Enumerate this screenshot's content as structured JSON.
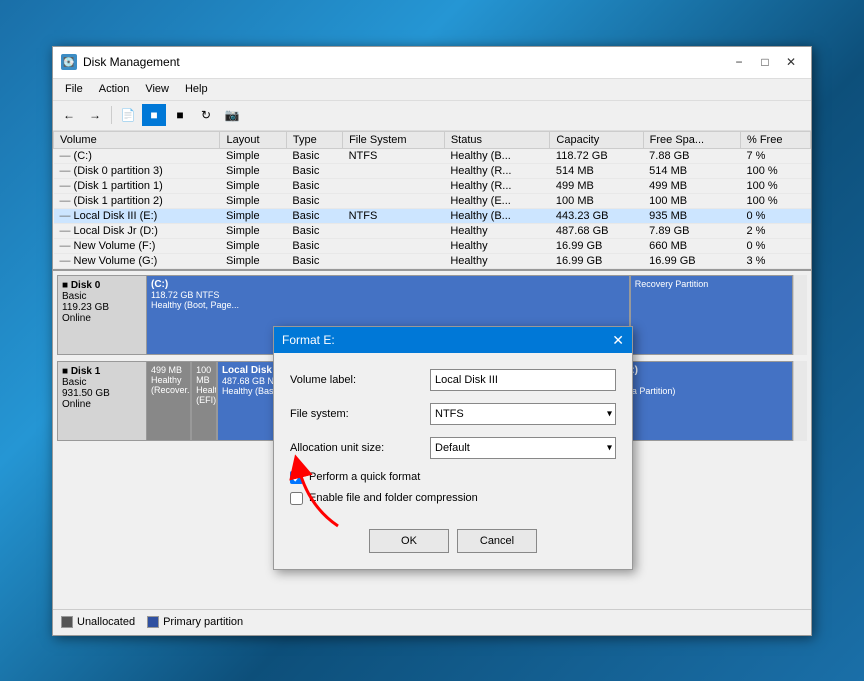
{
  "window": {
    "title": "Disk Management",
    "icon": "💽"
  },
  "menu": {
    "items": [
      "File",
      "Action",
      "View",
      "Help"
    ]
  },
  "table": {
    "headers": [
      "Volume",
      "Layout",
      "Type",
      "File System",
      "Status",
      "Capacity",
      "Free Spa...",
      "% Free"
    ],
    "rows": [
      [
        "(C:)",
        "Simple",
        "Basic",
        "NTFS",
        "Healthy (B...",
        "118.72 GB",
        "7.88 GB",
        "7 %"
      ],
      [
        "(Disk 0 partition 3)",
        "Simple",
        "Basic",
        "",
        "Healthy (R...",
        "514 MB",
        "514 MB",
        "100 %"
      ],
      [
        "(Disk 1 partition 1)",
        "Simple",
        "Basic",
        "",
        "Healthy (R...",
        "499 MB",
        "499 MB",
        "100 %"
      ],
      [
        "(Disk 1 partition 2)",
        "Simple",
        "Basic",
        "",
        "Healthy (E...",
        "100 MB",
        "100 MB",
        "100 %"
      ],
      [
        "Local Disk III (E:)",
        "Simple",
        "Basic",
        "NTFS",
        "Healthy (B...",
        "443.23 GB",
        "935 MB",
        "0 %"
      ],
      [
        "Local Disk Jr (D:)",
        "Simple",
        "Basic",
        "",
        "Healthy",
        "487.68 GB",
        "7.89 GB",
        "2 %"
      ],
      [
        "New Volume (F:)",
        "Simple",
        "Basic",
        "",
        "Healthy",
        "16.99 GB",
        "660 MB",
        "0 %"
      ],
      [
        "New Volume (G:)",
        "Simple",
        "Basic",
        "",
        "Healthy",
        "16.99 GB",
        "16.99 GB",
        "3 %"
      ]
    ]
  },
  "disk0": {
    "label": "Disk 0",
    "type": "Basic",
    "size": "119.23 GB",
    "status": "Online",
    "partitions": [
      {
        "name": "(C:)",
        "detail1": "118.72 GB NTFS",
        "detail2": "Healthy (Boot, Page...",
        "type": "data",
        "width": "70%"
      },
      {
        "name": "",
        "detail1": "",
        "detail2": "Recovery Partition",
        "type": "recovery",
        "width": "30%"
      }
    ]
  },
  "disk1": {
    "label": "Disk 1",
    "type": "Basic",
    "size": "931.50 GB",
    "status": "Online",
    "partitions": [
      {
        "name": "499 MB",
        "detail1": "Healthy (Recover...",
        "detail2": "",
        "type": "gray",
        "width": "6%"
      },
      {
        "name": "100 MB",
        "detail1": "Healthy (EFI)",
        "detail2": "",
        "type": "gray",
        "width": "4%"
      },
      {
        "name": "Local Disk Jr (D:)",
        "detail1": "487.68 GB NTFS",
        "detail2": "Healthy (Basic Data Partition)",
        "type": "data",
        "width": "52%"
      },
      {
        "name": "Local Disk III (E:)",
        "detail1": "443.23 GB NTFS",
        "detail2": "Healthy (Basic Data Partition)",
        "type": "data",
        "width": "38%"
      }
    ]
  },
  "legend": {
    "items": [
      {
        "color": "#555555",
        "label": "Unallocated"
      },
      {
        "color": "#3050a0",
        "label": "Primary partition"
      }
    ]
  },
  "dialog": {
    "title": "Format E:",
    "volume_label": "Volume label:",
    "volume_value": "Local Disk III",
    "filesystem_label": "File system:",
    "filesystem_value": "NTFS",
    "allocation_label": "Allocation unit size:",
    "allocation_value": "Default",
    "quick_format_label": "Perform a quick format",
    "quick_format_checked": true,
    "compression_label": "Enable file and folder compression",
    "compression_checked": false,
    "ok_label": "OK",
    "cancel_label": "Cancel"
  }
}
